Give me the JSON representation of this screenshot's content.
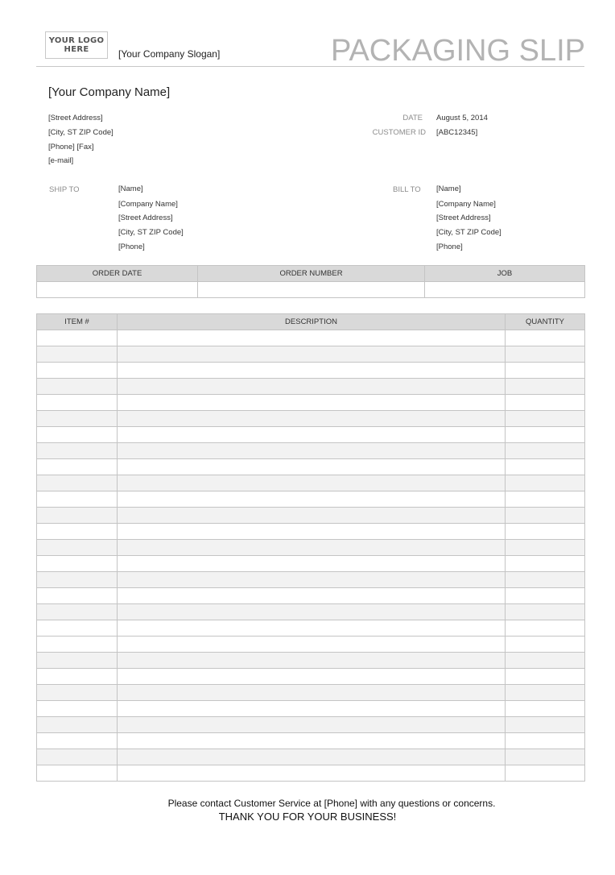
{
  "header": {
    "logo_line1": "YOUR LOGO",
    "logo_line2": "HERE",
    "slogan": "[Your Company Slogan]",
    "title": "PACKAGING SLIP"
  },
  "company": {
    "name": "[Your Company Name]",
    "street": "[Street Address]",
    "city": "[City, ST ZIP Code]",
    "phone_fax": "[Phone] [Fax]",
    "email": "[e-mail]"
  },
  "meta": {
    "date_label": "DATE",
    "date_value": "August 5, 2014",
    "customer_id_label": "CUSTOMER ID",
    "customer_id_value": "[ABC12345]"
  },
  "ship_to": {
    "label": "SHIP TO",
    "lines": [
      "[Name]",
      "[Company Name]",
      "[Street Address]",
      "[City, ST ZIP Code]",
      "[Phone]"
    ]
  },
  "bill_to": {
    "label": "BILL TO",
    "lines": [
      "[Name]",
      "[Company Name]",
      "[Street Address]",
      "[City, ST ZIP Code]",
      "[Phone]"
    ]
  },
  "order_table": {
    "headers": [
      "ORDER DATE",
      "ORDER NUMBER",
      "JOB"
    ],
    "row": [
      "",
      "",
      ""
    ]
  },
  "items_table": {
    "headers": [
      "ITEM #",
      "DESCRIPTION",
      "QUANTITY"
    ],
    "row_shading": [
      0,
      1,
      0,
      1,
      0,
      1,
      0,
      1,
      0,
      1,
      0,
      1,
      0,
      1,
      0,
      1,
      0,
      1,
      0,
      0,
      1,
      0,
      1,
      0,
      1,
      0,
      1,
      0
    ],
    "rows": []
  },
  "footer": {
    "contact": "Please contact Customer Service at [Phone] with any questions or concerns.",
    "thanks": "THANK YOU FOR YOUR BUSINESS!"
  }
}
